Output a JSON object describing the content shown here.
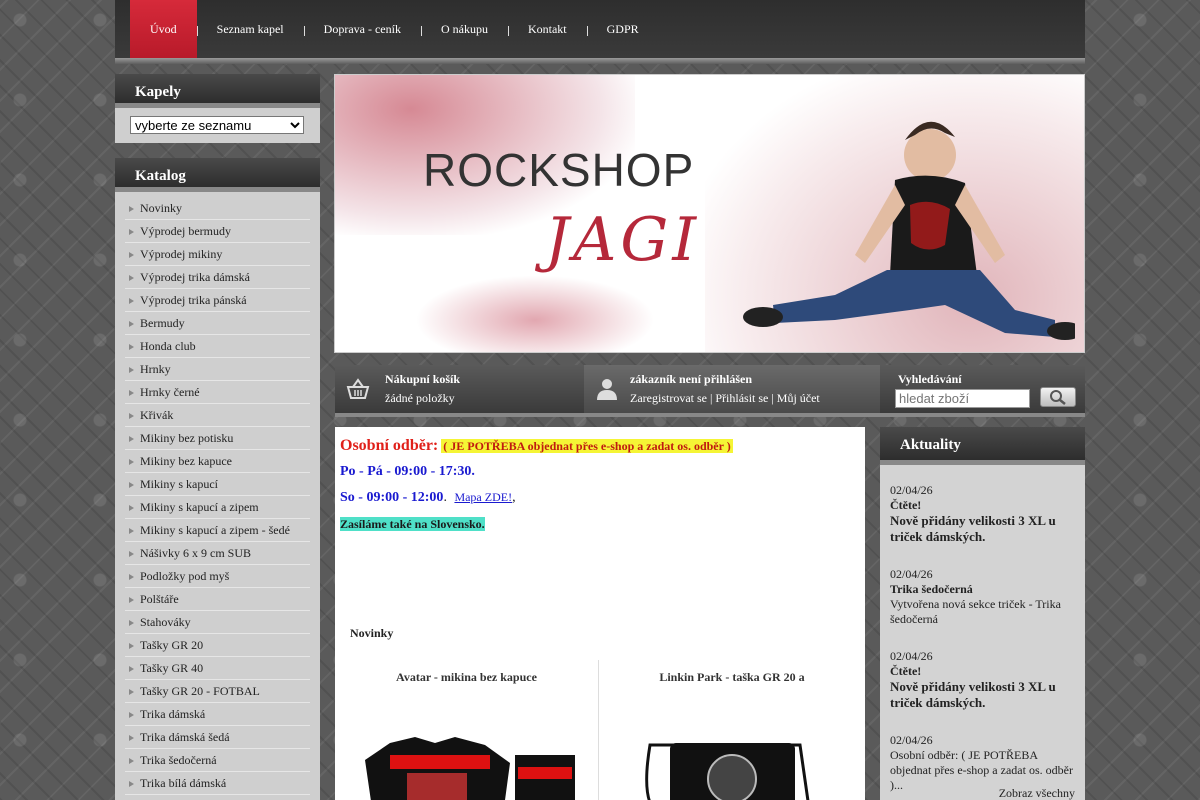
{
  "nav": {
    "items": [
      "Úvod",
      "Seznam kapel",
      "Doprava - ceník",
      "O nákupu",
      "Kontakt",
      "GDPR"
    ],
    "active": "Úvod"
  },
  "kapely": {
    "title": "Kapely",
    "select_value": "vyberte ze seznamu"
  },
  "katalog": {
    "title": "Katalog",
    "items": [
      "Novinky",
      "Výprodej bermudy",
      "Výprodej mikiny",
      "Výprodej trika dámská",
      "Výprodej trika pánská",
      "Bermudy",
      "Honda club",
      "Hrnky",
      "Hrnky černé",
      "Křivák",
      "Mikiny bez potisku",
      "Mikiny bez kapuce",
      "Mikiny s kapucí",
      "Mikiny s kapucí a zipem",
      "Mikiny s kapucí a zipem - šedé",
      "Nášivky 6 x 9 cm SUB",
      "Podložky pod myš",
      "Polštáře",
      "Stahováky",
      "Tašky GR 20",
      "Tašky GR 40",
      "Tašky GR 20 - FOTBAL",
      "Trika dámská",
      "Trika dámská šedá",
      "Trika šedočerná",
      "Trika bílá dámská"
    ]
  },
  "banner": {
    "brand": "ROCKSHOP",
    "script": "JAGI"
  },
  "cart": {
    "title": "Nákupní košík",
    "status": "žádné položky"
  },
  "user": {
    "title": "zákazník není přihlášen",
    "links": "Zaregistrovat se | Přihlásit se | Můj účet"
  },
  "search": {
    "title": "Vyhledávání",
    "placeholder": "hledat zboží"
  },
  "main": {
    "pickup_label": "Osobní odběr:",
    "pickup_note": "( JE POTŘEBA objednat přes e-shop a zadat os. odběr )",
    "hours_weekday": "Po - Pá - 09:00 - 17:30.",
    "hours_saturday": "So - 09:00 - 12:00",
    "hours_sep": ".",
    "map_link": "Mapa ZDE!",
    "map_comma": ",",
    "shipping_note": "Zasíláme také na Slovensko.",
    "novinky": "Novinky",
    "products": [
      {
        "name": "Avatar - mikina bez kapuce"
      },
      {
        "name": "Linkin Park - taška GR 20 a"
      }
    ]
  },
  "news": {
    "title": "Aktuality",
    "items": [
      {
        "date": "02/04/26",
        "head": "Čtěte!",
        "body": "Nově přidány velikosti 3 XL u triček dámských."
      },
      {
        "date": "02/04/26",
        "head": "Trika šedočerná",
        "body": "Vytvořena nová sekce triček - Trika šedočerná"
      },
      {
        "date": "02/04/26",
        "head": "Čtěte!",
        "body": "Nově přidány velikosti 3 XL u triček dámských."
      },
      {
        "date": "02/04/26",
        "head": "",
        "body": "Osobní odběr:  ( JE POTŘEBA objednat přes e-shop a zadat os. odběr )..."
      }
    ],
    "more": "Zobraz všechny"
  }
}
